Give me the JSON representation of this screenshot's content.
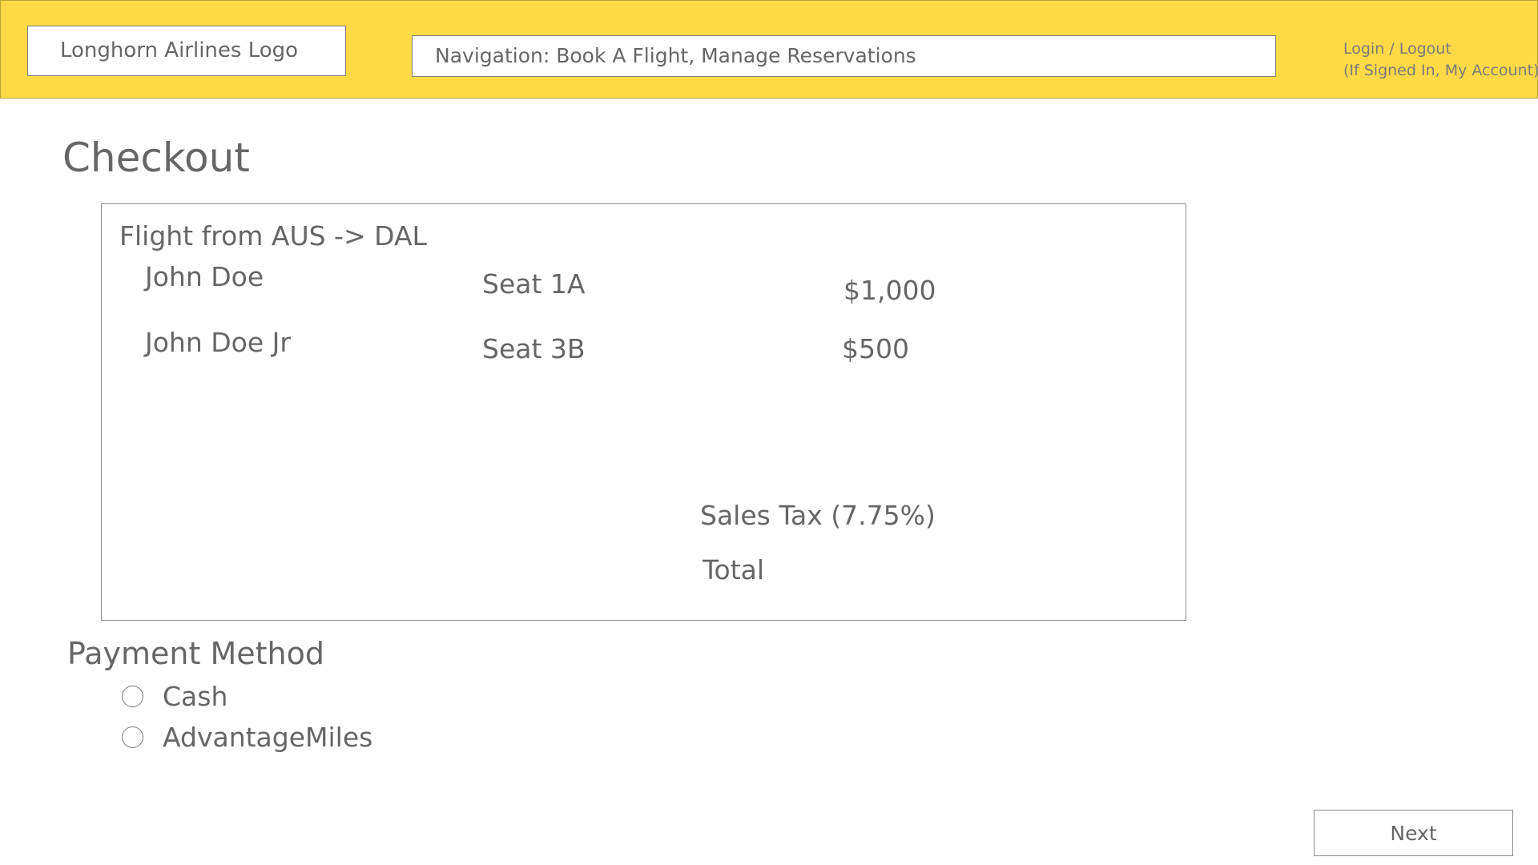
{
  "header": {
    "logo_text": "Longhorn Airlines Logo",
    "navigation_text": "Navigation: Book A Flight, Manage Reservations",
    "login_text": "Login / Logout",
    "account_text": "(If Signed In, My Account)",
    "background_color": "#ffd946"
  },
  "page": {
    "title": "Checkout"
  },
  "summary": {
    "flight_heading": "Flight from AUS -> DAL",
    "passengers": [
      {
        "name": "John Doe",
        "seat": "Seat 1A",
        "price": "$1,000"
      },
      {
        "name": "John Doe Jr",
        "seat": "Seat 3B",
        "price": "$500"
      }
    ],
    "sales_tax_label": "Sales Tax (7.75%)",
    "total_label": "Total"
  },
  "payment": {
    "title": "Payment Method",
    "options": [
      {
        "label": "Cash",
        "selected": false
      },
      {
        "label": "AdvantageMiles",
        "selected": false
      }
    ]
  },
  "actions": {
    "next_label": "Next"
  }
}
